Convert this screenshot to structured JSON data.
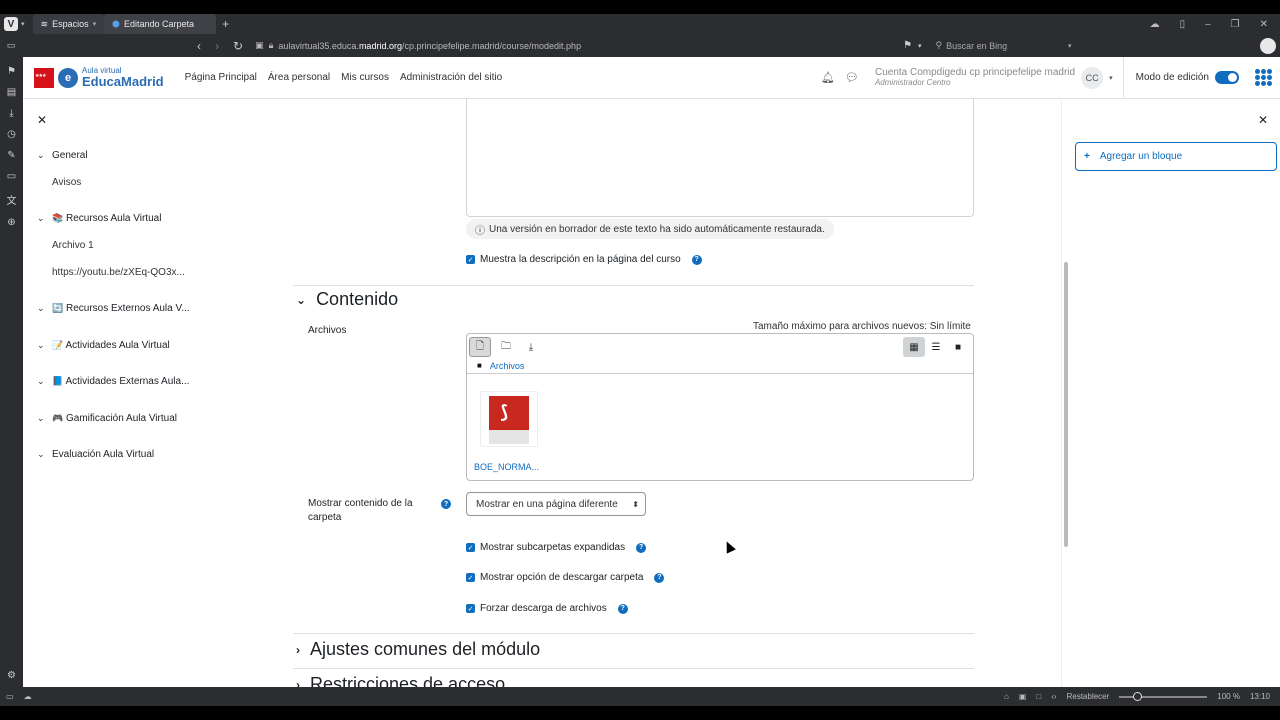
{
  "browser": {
    "tabs": [
      {
        "label": "Espacios"
      },
      {
        "label": "Editando Carpeta"
      }
    ],
    "url_prefix": "aulavirtual35.educa.",
    "url_domain": "madrid.org",
    "url_suffix": "/cp.principefelipe.madrid/course/modedit.php",
    "search_placeholder": "Buscar en Bing",
    "status": {
      "reset_label": "Restablecer",
      "zoom": "100 %",
      "time": "13:10"
    }
  },
  "navbar": {
    "logo_small": "Aula virtual",
    "logo_big": "EducaMadrid",
    "links": [
      "Página Principal",
      "Área personal",
      "Mis cursos",
      "Administración del sitio"
    ],
    "user_name": "Cuenta Compdigedu cp principefelipe madrid",
    "user_role": "Administrador Centro",
    "initials": "CC",
    "edit_mode_label": "Modo de edición"
  },
  "course_index": {
    "sections": [
      {
        "label": "General",
        "emoji": "",
        "children": [
          "Avisos"
        ]
      },
      {
        "label": "Recursos Aula Virtual",
        "emoji": "📚",
        "children": [
          "Archivo 1",
          "https://youtu.be/zXEq-QO3x..."
        ]
      },
      {
        "label": "Recursos Externos Aula V...",
        "emoji": "🔄",
        "children": []
      },
      {
        "label": "Actividades Aula Virtual",
        "emoji": "📝",
        "children": []
      },
      {
        "label": "Actividades Externas Aula...",
        "emoji": "📘",
        "children": []
      },
      {
        "label": "Gamificación Aula Virtual",
        "emoji": "🎮",
        "children": []
      },
      {
        "label": "Evaluación Aula Virtual",
        "emoji": "",
        "children": []
      }
    ]
  },
  "blocks": {
    "add_block_label": "Agregar un bloque"
  },
  "form": {
    "draft_notice": "Una versión en borrador de este texto ha sido automáticamente restaurada.",
    "show_description_label": "Muestra la descripción en la página del curso",
    "section_content": "Contenido",
    "files_label": "Archivos",
    "max_size": "Tamaño máximo para archivos nuevos: Sin límite",
    "filemanager_path": "Archivos",
    "file_name": "BOE_NORMA...",
    "display_label": "Mostrar contenido de la carpeta",
    "display_value": "Mostrar en una página diferente",
    "checkbox_subfolders": "Mostrar subcarpetas expandidas",
    "checkbox_download": "Mostrar opción de descargar carpeta",
    "checkbox_force": "Forzar descarga de archivos",
    "section_common": "Ajustes comunes del módulo",
    "section_restrictions": "Restricciones de acceso"
  }
}
